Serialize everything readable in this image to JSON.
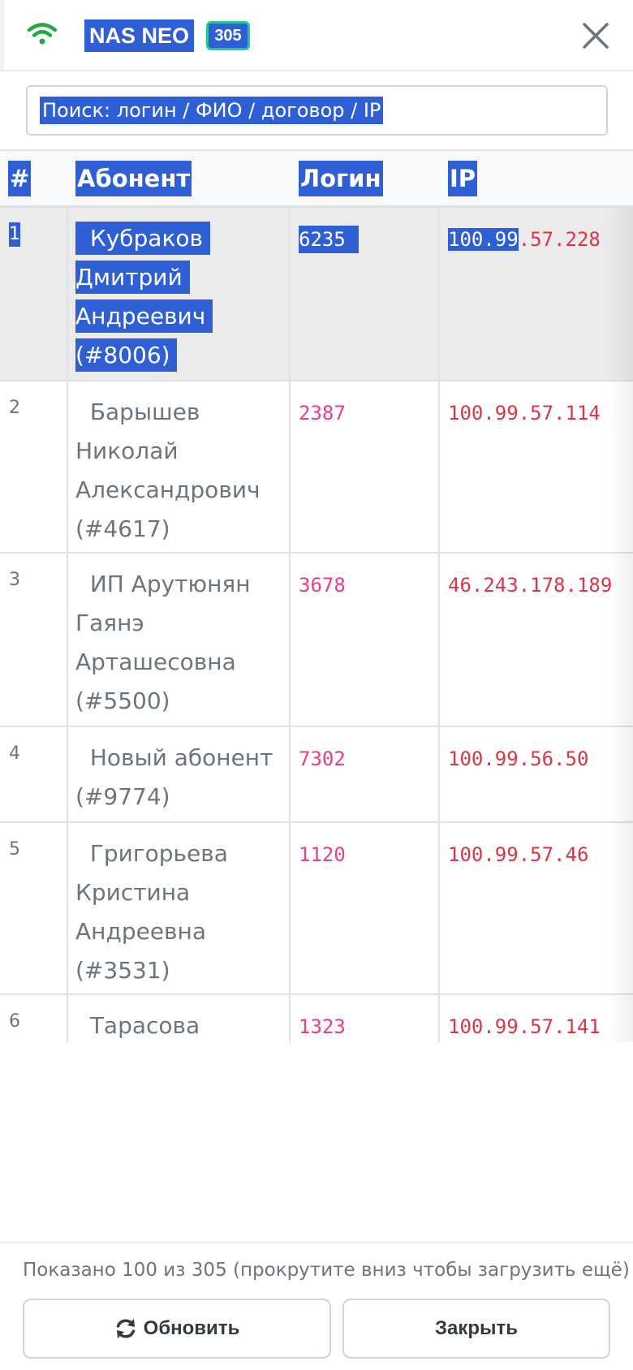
{
  "header": {
    "title": "NAS NEO",
    "badge": "305",
    "wifi_icon": "wifi-icon",
    "close_icon": "close-icon",
    "wifi_color": "#28a745"
  },
  "search": {
    "placeholder": "Поиск: логин / ФИО / договор / IP"
  },
  "table": {
    "columns": [
      "#",
      "Абонент",
      "Логин",
      "IP"
    ],
    "rows": [
      {
        "num": "1",
        "name": [
          "Кубраков",
          "Дмитрий",
          "Андреевич",
          "(#8006)"
        ],
        "login": "6235",
        "ip_sel": "100.99",
        "ip_rest": ".57.228"
      },
      {
        "num": "2",
        "name": [
          "Барышев",
          "Николай",
          "Александрович",
          "(#4617)"
        ],
        "login": "2387",
        "ip": "100.99.57.114"
      },
      {
        "num": "3",
        "name": [
          "ИП Арутюнян",
          "Гаянэ",
          "Арташесовна",
          "(#5500)"
        ],
        "login": "3678",
        "ip": "46.243.178.189"
      },
      {
        "num": "4",
        "name": [
          "Новый абонент",
          "(#9774)"
        ],
        "login": "7302",
        "ip": "100.99.56.50"
      },
      {
        "num": "5",
        "name": [
          "Григорьева",
          "Кристина",
          "Андреевна",
          "(#3531)"
        ],
        "login": "1120",
        "ip": "100.99.57.46"
      },
      {
        "num": "6",
        "name": [
          "Тарасова Ирина"
        ],
        "login": "1323",
        "ip": "100.99.57.141"
      }
    ]
  },
  "footer": {
    "info": "Показано 100 из 305 (прокрутите вниз чтобы загрузить ещё)",
    "refresh_label": "Обновить",
    "refresh_icon": "refresh-icon",
    "close_label": "Закрыть"
  },
  "colors": {
    "selection": "#2e5fd4",
    "login": "#e83e8c",
    "ip": "#dc3545",
    "badge_border": "#20c997"
  }
}
